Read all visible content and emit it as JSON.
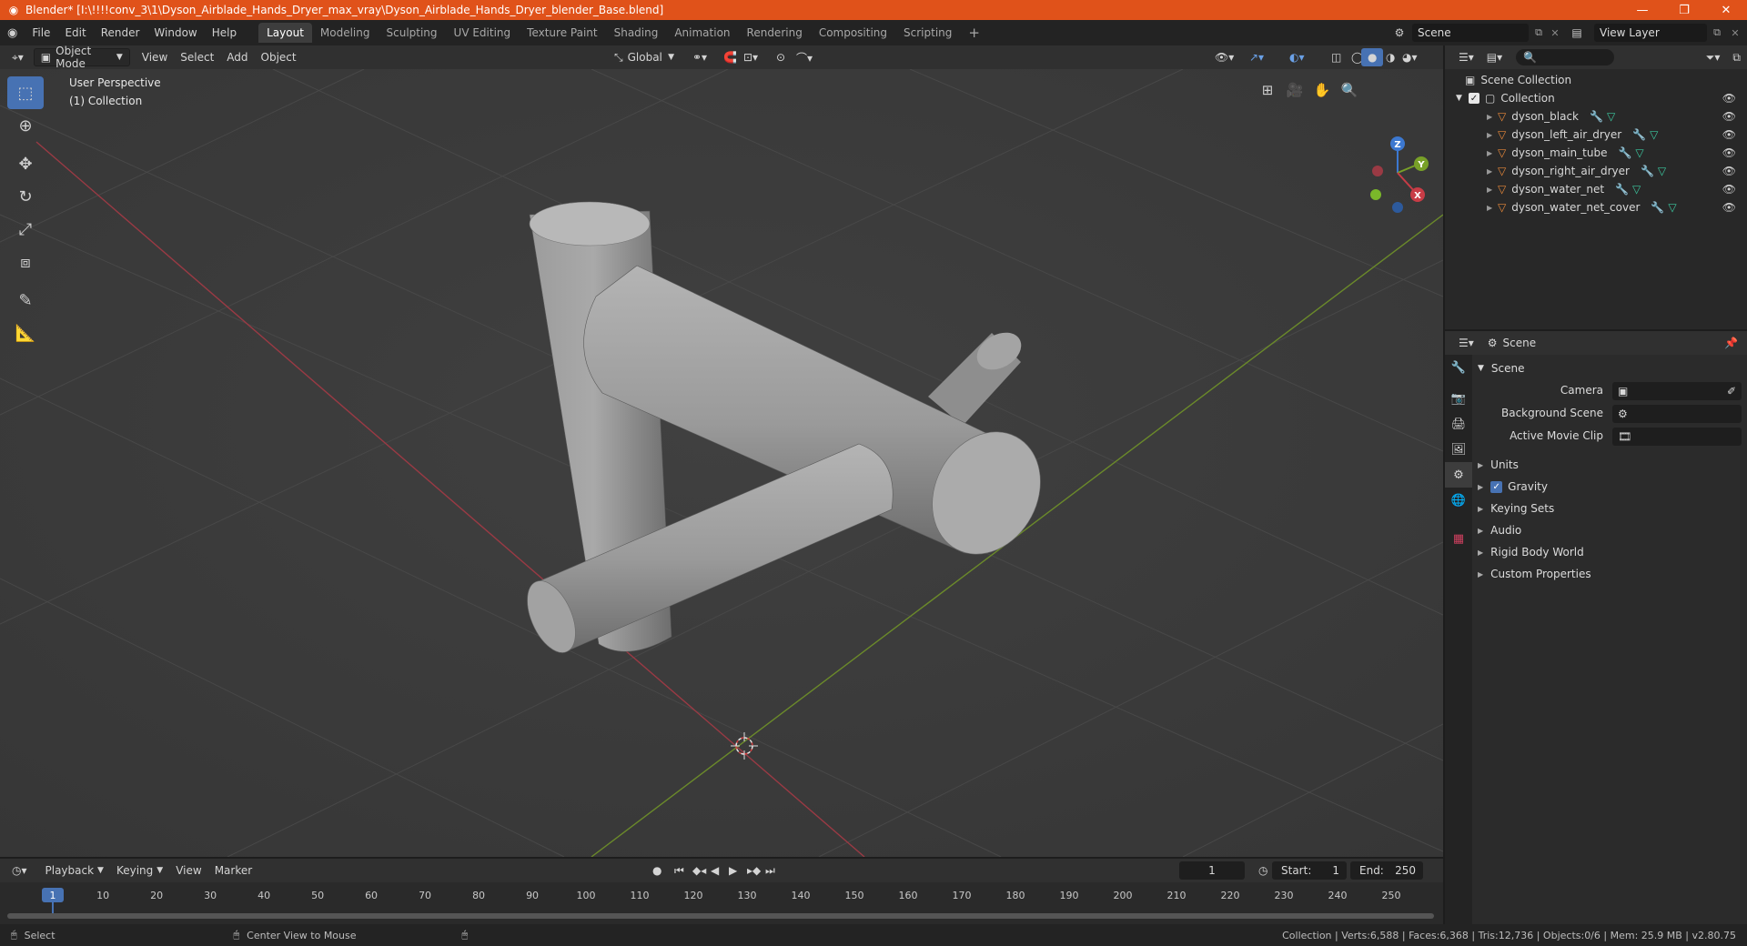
{
  "window": {
    "title": "Blender* [I:\\!!!!conv_3\\1\\Dyson_Airblade_Hands_Dryer_max_vray\\Dyson_Airblade_Hands_Dryer_blender_Base.blend]",
    "minimize": "—",
    "maximize": "❐",
    "close": "✕"
  },
  "menu": [
    "File",
    "Edit",
    "Render",
    "Window",
    "Help"
  ],
  "workspaces": [
    "Layout",
    "Modeling",
    "Sculpting",
    "UV Editing",
    "Texture Paint",
    "Shading",
    "Animation",
    "Rendering",
    "Compositing",
    "Scripting"
  ],
  "active_workspace": "Layout",
  "add_workspace": "+",
  "scene_name": "Scene",
  "view_layer": "View Layer",
  "viewport_header": {
    "mode": "Object Mode",
    "menus": [
      "View",
      "Select",
      "Add",
      "Object"
    ],
    "orientation": "Global"
  },
  "viewport": {
    "perspective": "User Perspective",
    "collection": "(1) Collection",
    "axis_labels": {
      "x": "X",
      "y": "Y",
      "z": "Z"
    }
  },
  "outliner": {
    "root": "Scene Collection",
    "collection": "Collection",
    "objects": [
      "dyson_black",
      "dyson_left_air_dryer",
      "dyson_main_tube",
      "dyson_right_air_dryer",
      "dyson_water_net",
      "dyson_water_net_cover"
    ]
  },
  "properties": {
    "header": "Scene",
    "panel_title": "Scene",
    "fields": [
      {
        "label": "Camera",
        "value": ""
      },
      {
        "label": "Background Scene",
        "value": ""
      },
      {
        "label": "Active Movie Clip",
        "value": ""
      }
    ],
    "subpanels": [
      "Units",
      "Gravity",
      "Keying Sets",
      "Audio",
      "Rigid Body World",
      "Custom Properties"
    ],
    "gravity_checked": true
  },
  "timeline": {
    "menus": [
      "Playback",
      "Keying",
      "View",
      "Marker"
    ],
    "current_frame": "1",
    "start_label": "Start:",
    "start": "1",
    "end_label": "End:",
    "end": "250",
    "ruler": [
      "1",
      "10",
      "20",
      "30",
      "40",
      "50",
      "60",
      "70",
      "80",
      "90",
      "100",
      "110",
      "120",
      "130",
      "140",
      "150",
      "160",
      "170",
      "180",
      "190",
      "200",
      "210",
      "220",
      "230",
      "240",
      "250"
    ]
  },
  "status": {
    "left": "Select",
    "middle": "Center View to Mouse",
    "right": "Collection | Verts:6,588 | Faces:6,368 | Tris:12,736 | Objects:0/6 | Mem: 25.9 MB | v2.80.75"
  },
  "colors": {
    "accent": "#4772b3",
    "titlebar": "#e0521a",
    "x_axis": "#c83c46",
    "y_axis": "#78a028",
    "z_axis": "#3c78d0"
  }
}
